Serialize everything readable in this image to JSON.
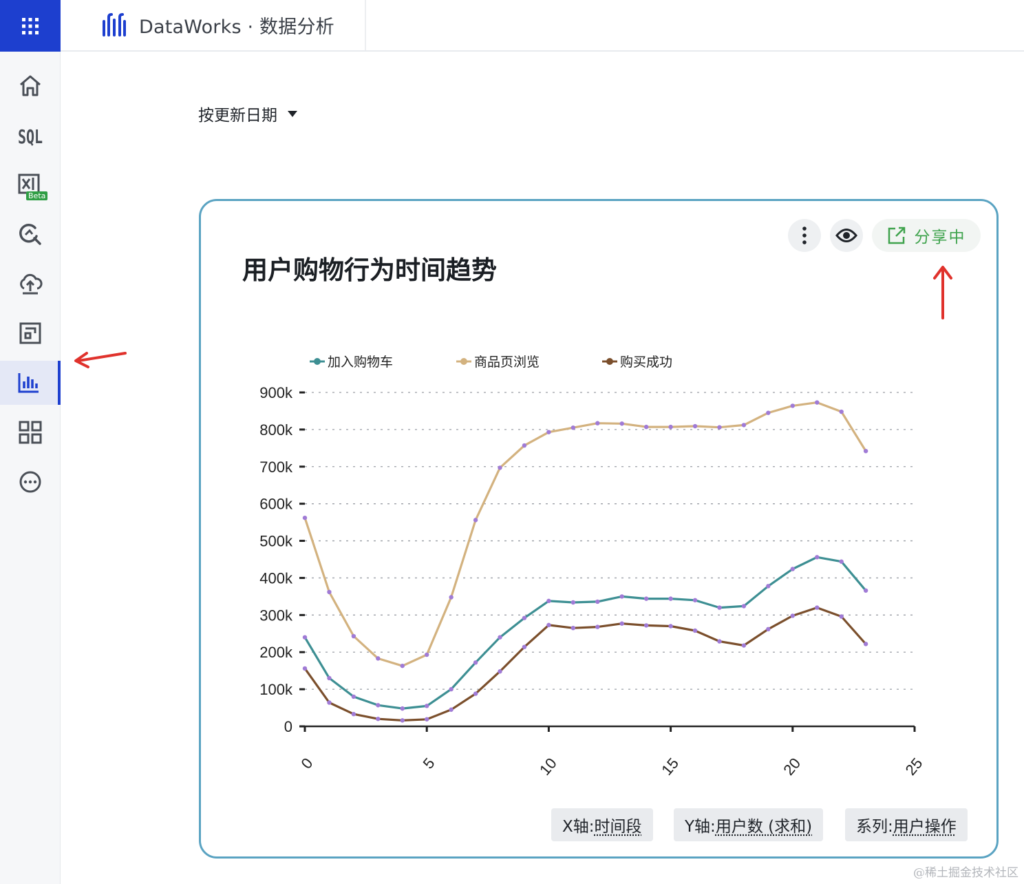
{
  "header": {
    "title": "DataWorks · 数据分析",
    "brand_color": "#1d3fcf"
  },
  "sidebar": {
    "items": [
      {
        "icon": "home-icon"
      },
      {
        "icon": "sql-icon",
        "label": "SQL"
      },
      {
        "icon": "excel-icon",
        "badge": "Beta"
      },
      {
        "icon": "analysis-icon"
      },
      {
        "icon": "upload-cloud-icon"
      },
      {
        "icon": "dashboard-icon"
      },
      {
        "icon": "bar-chart-icon",
        "active": true
      },
      {
        "icon": "grid-apps-icon"
      },
      {
        "icon": "more-icon"
      }
    ]
  },
  "sort": {
    "label": "按更新日期"
  },
  "card": {
    "title": "用户购物行为时间趋势",
    "share_label": "分享中",
    "chips": [
      {
        "prefix": "X轴: ",
        "value": "时间段"
      },
      {
        "prefix": "Y轴: ",
        "value": "用户数 (求和)"
      },
      {
        "prefix": "系列: ",
        "value": "用户操作"
      }
    ]
  },
  "chart_data": {
    "type": "line",
    "title": "用户购物行为时间趋势",
    "x": [
      0,
      1,
      2,
      3,
      4,
      5,
      6,
      7,
      8,
      9,
      10,
      11,
      12,
      13,
      14,
      15,
      16,
      17,
      18,
      19,
      20,
      21,
      22,
      23
    ],
    "xlim": [
      0,
      25
    ],
    "x_ticks": [
      "0",
      "5",
      "10",
      "15",
      "20",
      "25"
    ],
    "ylim": [
      0,
      900000
    ],
    "y_ticks": [
      "0",
      "100k",
      "200k",
      "300k",
      "400k",
      "500k",
      "600k",
      "700k",
      "800k",
      "900k"
    ],
    "grid": true,
    "legend_position": "top-left",
    "series": [
      {
        "name": "加入购物车",
        "color": "#3d8f93",
        "values": [
          240000,
          130000,
          80000,
          57000,
          48000,
          55000,
          100000,
          172000,
          240000,
          292000,
          338000,
          334000,
          336000,
          350000,
          344000,
          344000,
          340000,
          320000,
          324000,
          378000,
          424000,
          456000,
          444000,
          366000
        ]
      },
      {
        "name": "商品页浏览",
        "color": "#d3b27f",
        "values": [
          562000,
          362000,
          243000,
          183000,
          163000,
          193000,
          348000,
          556000,
          697000,
          757000,
          793000,
          805000,
          817000,
          816000,
          807000,
          807000,
          809000,
          806000,
          812000,
          845000,
          864000,
          873000,
          848000,
          742000
        ]
      },
      {
        "name": "购买成功",
        "color": "#7b4f2c",
        "values": [
          156000,
          64000,
          33000,
          20000,
          16000,
          19000,
          45000,
          88000,
          148000,
          214000,
          273000,
          265000,
          268000,
          277000,
          272000,
          270000,
          258000,
          229000,
          218000,
          262000,
          298000,
          320000,
          296000,
          222000
        ]
      }
    ],
    "marker_color": "#a07bd6"
  },
  "watermark": "@稀土掘金技术社区"
}
